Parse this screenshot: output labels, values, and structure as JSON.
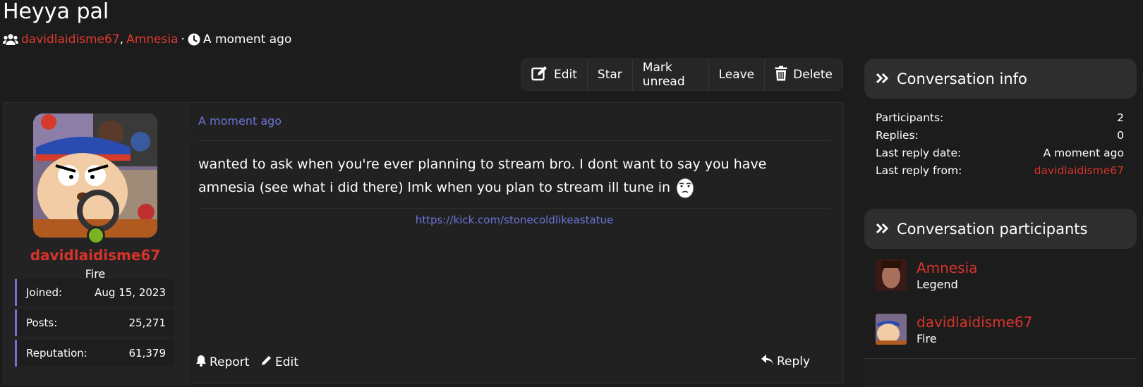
{
  "thread": {
    "title": "Heyya pal",
    "participants": [
      "davidlaidisme67",
      "Amnesia"
    ],
    "separator": ",",
    "dot": "·",
    "time": "A moment ago"
  },
  "toolbar": {
    "edit": "Edit",
    "star": "Star",
    "mark_unread": "Mark unread",
    "leave": "Leave",
    "delete": "Delete"
  },
  "post": {
    "date": "A moment ago",
    "author": "davidlaidisme67",
    "author_title": "Fire",
    "stats": [
      {
        "label": "Joined:",
        "value": "Aug 15, 2023"
      },
      {
        "label": "Posts:",
        "value": "25,271"
      },
      {
        "label": "Reputation:",
        "value": "61,379"
      }
    ],
    "message": "wanted to ask when you're ever planning to stream bro. I dont want to say you have amnesia (see what i did there) lmk when you plan to stream ill tune in",
    "signature_link": "https://kick.com/stonecoldlikeastatue",
    "actions": {
      "report": "Report",
      "edit": "Edit",
      "reply": "Reply"
    }
  },
  "info": {
    "heading": "Conversation info",
    "rows": [
      {
        "label": "Participants:",
        "value": "2"
      },
      {
        "label": "Replies:",
        "value": "0"
      },
      {
        "label": "Last reply date:",
        "value": "A moment ago"
      },
      {
        "label": "Last reply from:",
        "value": "davidlaidisme67"
      }
    ]
  },
  "participants_box": {
    "heading": "Conversation participants",
    "list": [
      {
        "name": "Amnesia",
        "title": "Legend"
      },
      {
        "name": "davidlaidisme67",
        "title": "Fire"
      }
    ]
  },
  "colors": {
    "background": "#1c1c1c",
    "link_red": "#e03a30",
    "accent_blue": "#6c74d6",
    "online_green": "#7bb324"
  },
  "icons": [
    "users-icon",
    "clock-icon",
    "edit-icon",
    "trash-icon",
    "bell-icon",
    "pencil-icon",
    "reply-icon",
    "chevrons-right-icon"
  ]
}
